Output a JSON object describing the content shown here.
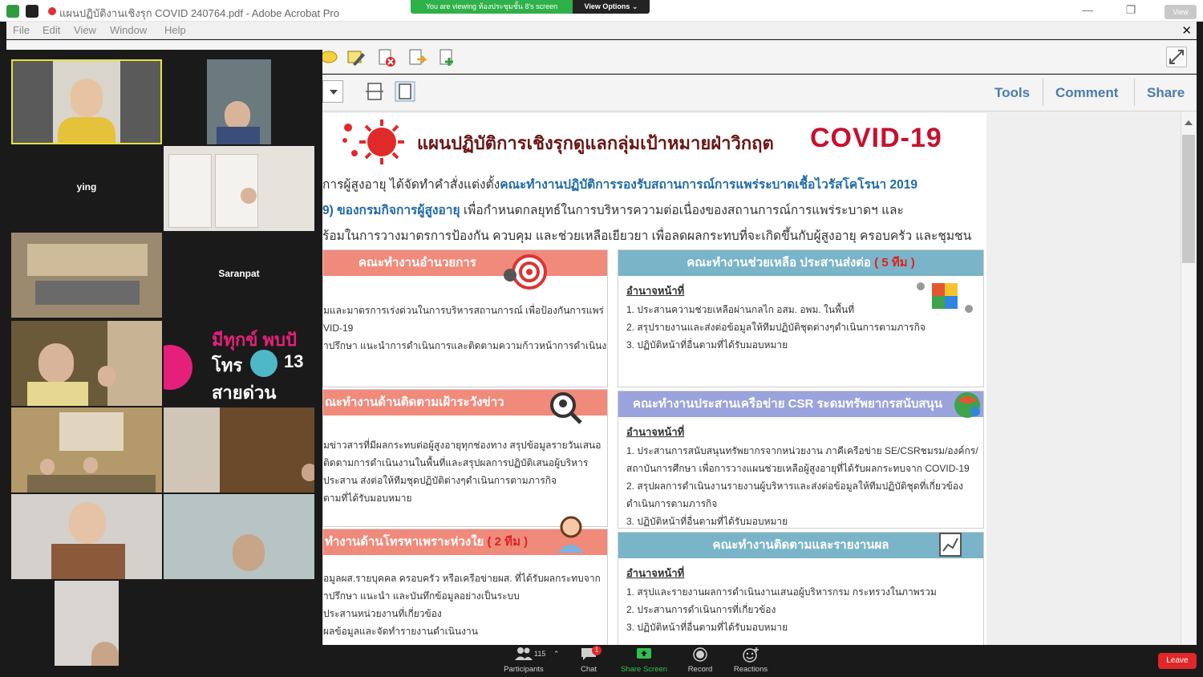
{
  "window": {
    "title": "แผนปฏิบัติงานเชิงรุก COVID 240764.pdf - Adobe Acrobat Pro",
    "minimize": "—",
    "restore": "❐",
    "close": "✕",
    "view_pill": "View"
  },
  "zoom_share": {
    "banner": "You are viewing ห้องประชุมชั้น 8's screen",
    "view_options": "View Options ⌄"
  },
  "menu": [
    "File",
    "Edit",
    "View",
    "Window",
    "Help"
  ],
  "menu_close": "✕",
  "panels": {
    "tools": "Tools",
    "comment": "Comment",
    "share": "Share"
  },
  "pdf": {
    "title": "แผนปฏิบัติการเชิงรุกดูแลกลุ่มเป้าหมายฝ่าวิกฤต",
    "logo": "COVID-19",
    "intro": [
      {
        "dark": "การผู้สูงอายุ ได้จัดทำคำสั่งแต่งตั้ง",
        "blue": "คณะทำงานปฏิบัติการรองรับสถานการณ์การแพร่ระบาดเชื้อไวรัสโคโรนา 2019"
      },
      {
        "dark": "",
        "blue": "9) ของกรมกิจการผู้สูงอายุ",
        "tail": " เพื่อกำหนดกลยุทธ์ในการบริหารความต่อเนื่องของสถานการณ์การแพร่ระบาดฯ และ"
      },
      {
        "dark": "ร้อมในการวางมาตรการป้องกัน ควบคุม และช่วยเหลือเยียวยา เพื่อลดผลกระทบที่จะเกิดขึ้นกับผู้สูงอายุ ครอบครัว และชุมชน",
        "blue": ""
      }
    ],
    "box_admin": {
      "head": "คณะทำงานอำนวยการ",
      "lines": [
        "มและมาตรการเร่งด่วนในการบริหารสถานการณ์ เพื่อป้องกันการแพร่",
        "VID-19",
        "ำปรึกษา แนะนำการดำเนินการและติดตามความก้าวหน้าการดำเนินงาน"
      ]
    },
    "box_help": {
      "head": "คณะทำงานช่วยเหลือ ประสานส่งต่อ",
      "accent": " ( 5 ทีม )",
      "sub": "อำนาจหน้าที่",
      "lines": [
        "1.  ประสานความช่วยเหลือผ่านกลไก อสม. อพม. ในพื้นที่",
        "2.  สรุปรายงานและส่งต่อข้อมูลให้ทีมปฏิบัติชุดต่างๆดำเนินการตามภารกิจ",
        "3.  ปฏิบัติหน้าที่อื่นตามที่ได้รับมอบหมาย"
      ]
    },
    "box_watch": {
      "head": "ณะทำงานด้านติดตามเฝ้าระวังข่าว",
      "lines": [
        "มข่าวสารที่มีผลกระทบต่อผู้สูงอายุทุกช่องทาง สรุปข้อมูลรายวันเสนอ",
        "",
        "ติดตามการดำเนินงานในพื้นที่และสรุปผลการปฏิบัติเสนอผู้บริหาร",
        "ประสาน ส่งต่อให้ทีมชุดปฏิบัติต่างๆดำเนินการตามภารกิจ",
        "ตามที่ได้รับมอบหมาย"
      ]
    },
    "box_csr": {
      "head": "คณะทำงานประสานเครือข่าย CSR ระดมทรัพยากรสนับสนุน",
      "sub": "อำนาจหน้าที่",
      "lines": [
        "1.  ประสานการสนับสนุนทรัพยากรจากหน่วยงาน ภาคีเครือข่าย SE/CSRชมรม/องค์กร/",
        "     สถาบันการศึกษา เพื่อการวางแผนช่วยเหลือผู้สูงอายุที่ได้รับผลกระทบจาก COVID-19",
        "2.  สรุปผลการดำเนินงานรายงานผู้บริหารและส่งต่อข้อมูลให้ทีมปฏิบัติชุดที่เกี่ยวข้อง",
        "     ดำเนินการตามภารกิจ",
        "3.  ปฏิบัติหน้าที่อื่นตามที่ได้รับมอบหมาย"
      ]
    },
    "box_call": {
      "head": "ทำงานด้านโทรหาเพราะห่วงใย",
      "accent": " ( 2 ทีม )",
      "lines": [
        "อมูลผส.รายบุคคล ครอบครัว หรือเครือข่ายผส. ที่ได้รับผลกระทบจาก",
        "ำปรึกษา แนะนำ และบันทึกข้อมูลอย่างเป็นระบบ",
        "  ประสานหน่วยงานที่เกี่ยวข้อง",
        "ผลข้อมูลและจัดทำรายงานดำเนินงาน"
      ]
    },
    "box_report": {
      "head": "คณะทำงานติดตามและรายงานผล",
      "sub": "อำนาจหน้าที่",
      "lines": [
        "1.  สรุปและรายงานผลการดำเนินงานเสนอผู้บริหารกรม กระทรวงในภาพรวม",
        "2.  ประสานการดำเนินการที่เกี่ยวข้อง",
        "3.  ปฏิบัติหน้าที่อื่นตามที่ได้รับมอบหมาย"
      ]
    }
  },
  "gallery": {
    "names": {
      "ying": "ying",
      "saranpat": "Saranpat"
    },
    "hotline_a": "มีทุกข์ พบปั",
    "hotline_b": "โทร",
    "hotline_c": "13",
    "hotline_d": "สายด่วน"
  },
  "zoom_controls": {
    "participants": "Participants",
    "participants_count": "115",
    "chat": "Chat",
    "chat_badge": "1",
    "share_screen": "Share Screen",
    "record": "Record",
    "reactions": "Reactions",
    "leave": "Leave"
  },
  "colors": {
    "zoom_green": "#2fb14a",
    "leave_red": "#e02828",
    "box_salmon": "#f08a7a",
    "box_teal": "#7ab4c8",
    "box_lavender": "#9aa3dc",
    "link_blue": "#4a7cae"
  }
}
